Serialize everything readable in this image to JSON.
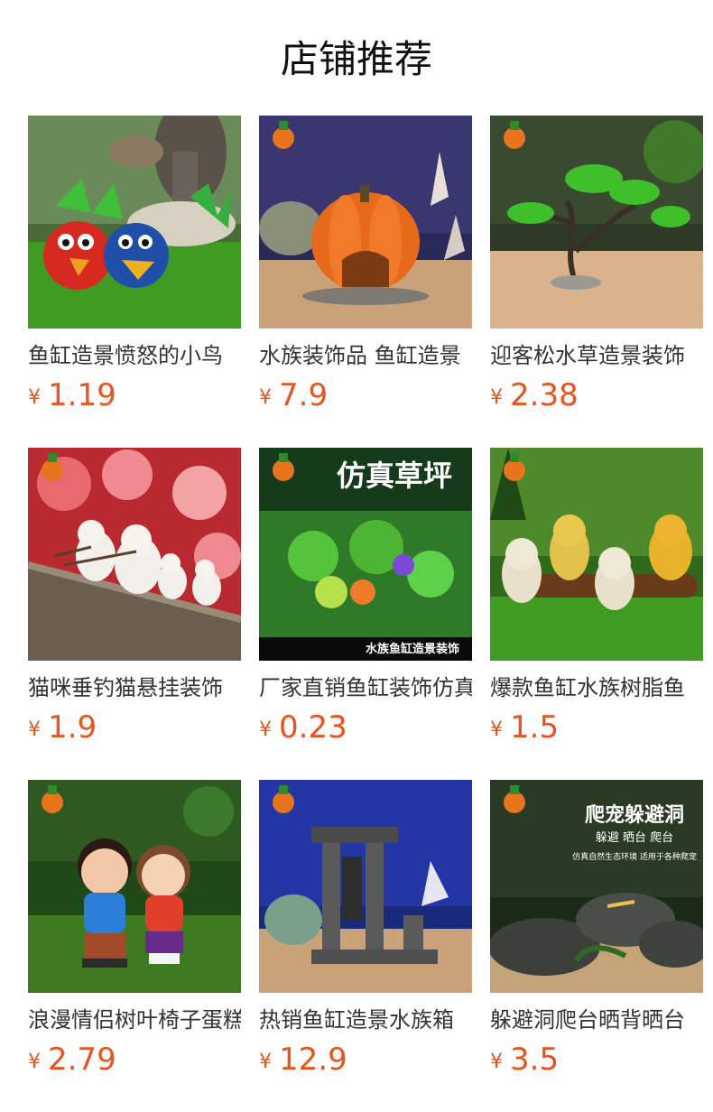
{
  "page": {
    "title": "店铺推荐"
  },
  "colors": {
    "price": "#e8541e",
    "text": "#333333"
  },
  "products": [
    {
      "name": "鱼缸造景愤怒的小鸟",
      "currency": "¥",
      "price": "1.19",
      "image": "angry-birds-figurines"
    },
    {
      "name": "水族装饰品 鱼缸造景",
      "currency": "¥",
      "price": "7.9",
      "image": "pumpkin-house"
    },
    {
      "name": "迎客松水草造景装饰",
      "currency": "¥",
      "price": "2.38",
      "image": "bonsai-pine-tree"
    },
    {
      "name": "猫咪垂钓猫悬挂装饰",
      "currency": "¥",
      "price": "1.9",
      "image": "fishing-cats"
    },
    {
      "name": "厂家直销鱼缸装饰仿真",
      "currency": "¥",
      "price": "0.23",
      "image": "artificial-grass",
      "overlay": {
        "headline": "仿真草坪",
        "caption": "水族鱼缸造景装饰"
      }
    },
    {
      "name": "爆款鱼缸水族树脂鱼",
      "currency": "¥",
      "price": "1.5",
      "image": "owl-figurines"
    },
    {
      "name": "浪漫情侣树叶椅子蛋糕",
      "currency": "¥",
      "price": "2.79",
      "image": "couple-figurines"
    },
    {
      "name": "热销鱼缸造景水族箱",
      "currency": "¥",
      "price": "12.9",
      "image": "stone-ruins"
    },
    {
      "name": "躲避洞爬台晒背晒台",
      "currency": "¥",
      "price": "3.5",
      "image": "reptile-cave",
      "overlay": {
        "headline": "爬宠躲避洞",
        "sub": "躲避  晒台  爬台",
        "caption": "仿真自然生态环境 适用于各种爬宠"
      }
    }
  ]
}
